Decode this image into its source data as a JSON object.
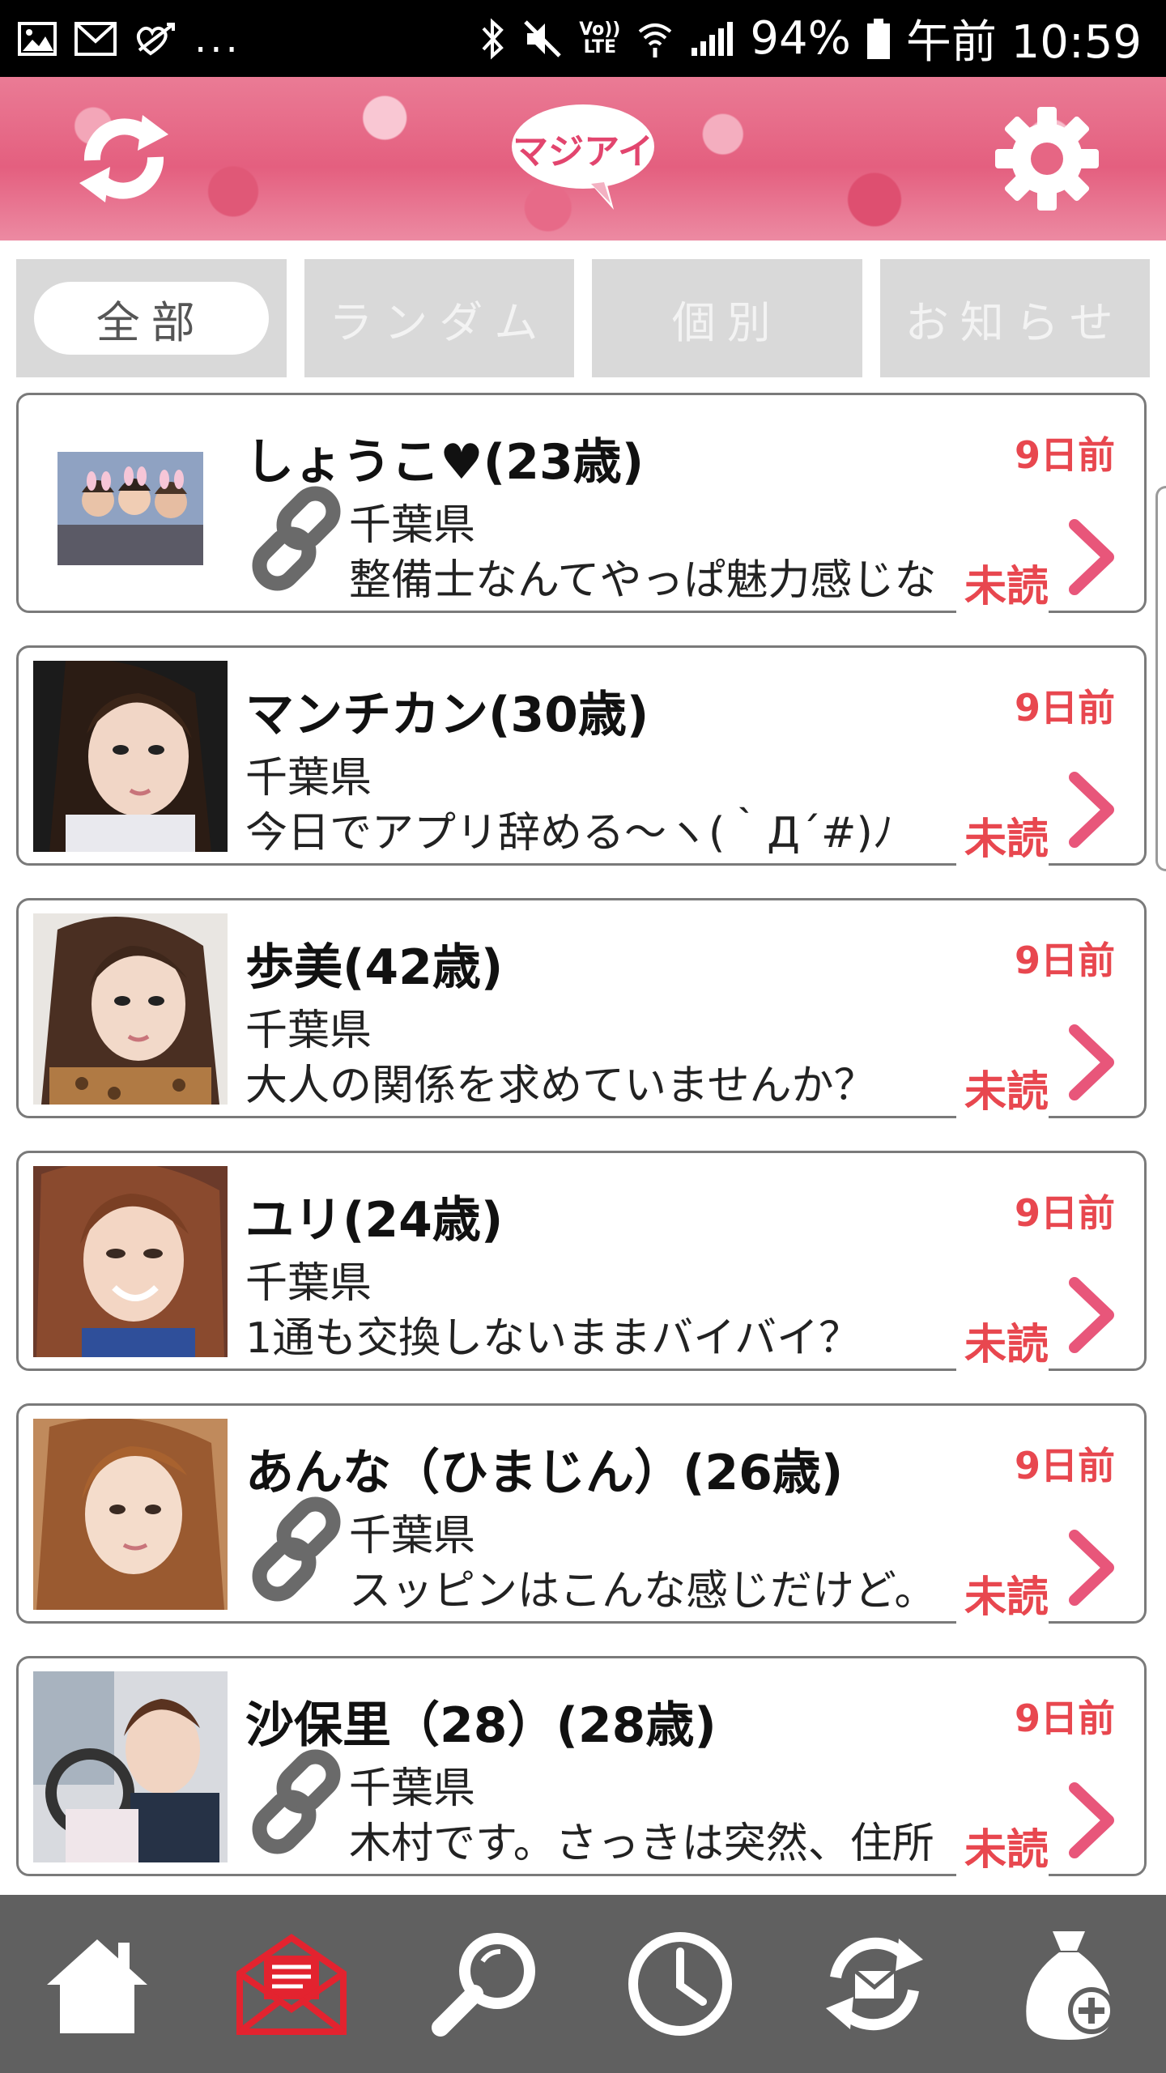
{
  "status_bar": {
    "battery": "94%",
    "time": "午前 10:59",
    "overflow": "...",
    "lte_label": "LTE",
    "volte_label": "Vo))"
  },
  "header": {
    "logo_text": "マジアイ",
    "accent_color": "#e45f7f"
  },
  "tabs": [
    {
      "label": "全部",
      "active": true
    },
    {
      "label": "ランダム",
      "active": false
    },
    {
      "label": "個別",
      "active": false
    },
    {
      "label": "お知らせ",
      "active": false
    }
  ],
  "messages": [
    {
      "name": "しょうこ♥(23歳)",
      "prefecture": "千葉県",
      "message": "整備士なんてやっぱ魅力感じな",
      "time": "9日前",
      "status": "未読",
      "linked": true
    },
    {
      "name": "マンチカン(30歳)",
      "prefecture": "千葉県",
      "message": "今日でアプリ辞める～ヽ(｀Д´#)ﾉ",
      "time": "9日前",
      "status": "未読",
      "linked": false
    },
    {
      "name": "歩美(42歳)",
      "prefecture": "千葉県",
      "message": "大人の関係を求めていませんか？",
      "time": "9日前",
      "status": "未読",
      "linked": false
    },
    {
      "name": "ユリ(24歳)",
      "prefecture": "千葉県",
      "message": "1通も交換しないままバイバイ？",
      "time": "9日前",
      "status": "未読",
      "linked": false
    },
    {
      "name": "あんな（ひまじん）(26歳)",
      "prefecture": "千葉県",
      "message": "スッピンはこんな感じだけど。",
      "time": "9日前",
      "status": "未読",
      "linked": true
    },
    {
      "name": "沙保里（28）(28歳)",
      "prefecture": "千葉県",
      "message": "木村です。さっきは突然、住所",
      "time": "9日前",
      "status": "未読",
      "linked": true
    }
  ],
  "bottom_nav": [
    {
      "icon": "home-icon",
      "active": false
    },
    {
      "icon": "mail-icon",
      "active": true
    },
    {
      "icon": "search-icon",
      "active": false
    },
    {
      "icon": "clock-icon",
      "active": false
    },
    {
      "icon": "refresh-mail-icon",
      "active": false
    },
    {
      "icon": "bag-add-icon",
      "active": false
    }
  ],
  "colors": {
    "time_red": "#e8474f",
    "chevron_pink": "#e8567a",
    "nav_active": "#e3232f"
  }
}
